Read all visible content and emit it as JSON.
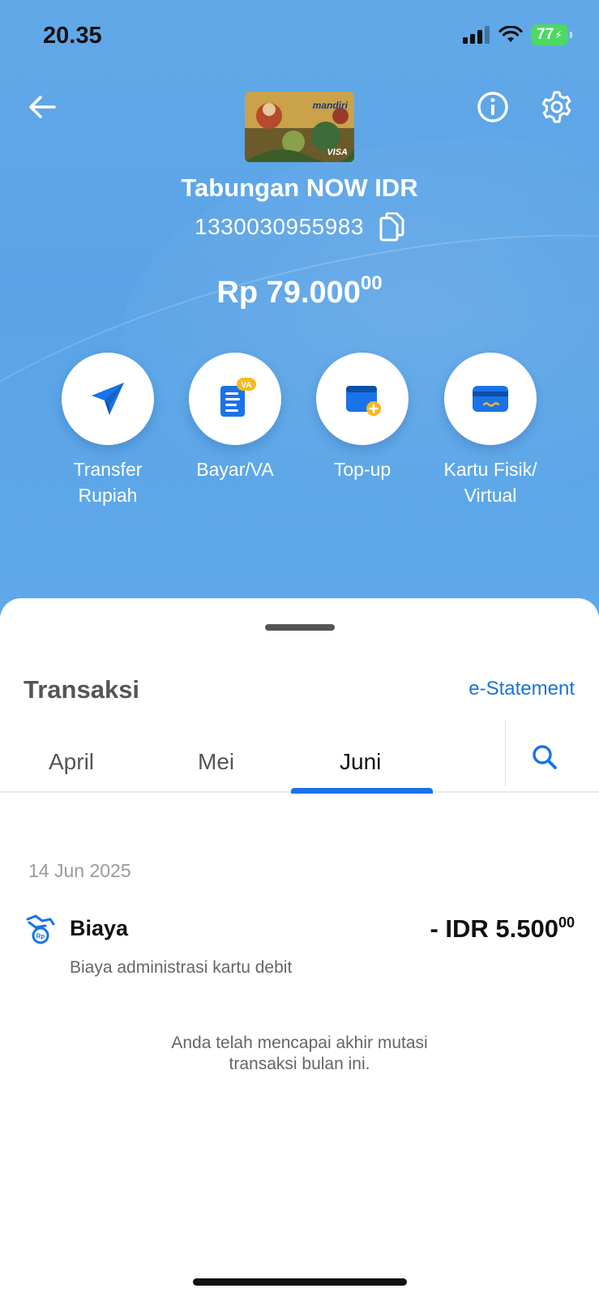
{
  "status_bar": {
    "time": "20.35",
    "battery": "77"
  },
  "header": {
    "icons": {
      "back": "arrow-left-icon",
      "info": "info-icon",
      "settings": "gear-icon"
    },
    "card": {
      "brand": "mandiri",
      "network": "VISA"
    }
  },
  "account": {
    "name": "Tabungan NOW IDR",
    "number": "1330030955983",
    "balance_main": "Rp 79.000",
    "balance_cents": "00"
  },
  "actions": [
    {
      "label": "Transfer\nRupiah",
      "icon": "paper-plane-icon"
    },
    {
      "label": "Bayar/VA",
      "icon": "va-bill-icon",
      "badge": "VA"
    },
    {
      "label": "Top-up",
      "icon": "wallet-add-icon"
    },
    {
      "label": "Kartu Fisik/\nVirtual",
      "icon": "card-icon"
    }
  ],
  "transactions": {
    "title": "Transaksi",
    "estatement": "e-Statement",
    "tabs": [
      "April",
      "Mei",
      "Juni"
    ],
    "active_tab": "Juni",
    "groups": [
      {
        "date": "14 Jun 2025",
        "items": [
          {
            "name": "Biaya",
            "description": "Biaya administrasi kartu debit",
            "amount_main": "- IDR 5.500",
            "amount_cents": "00"
          }
        ]
      }
    ],
    "end_note": "Anda telah mencapai akhir mutasi\ntransaksi bulan ini."
  },
  "colors": {
    "accent": "#1a73e8",
    "hero": "#5aa3e6"
  }
}
